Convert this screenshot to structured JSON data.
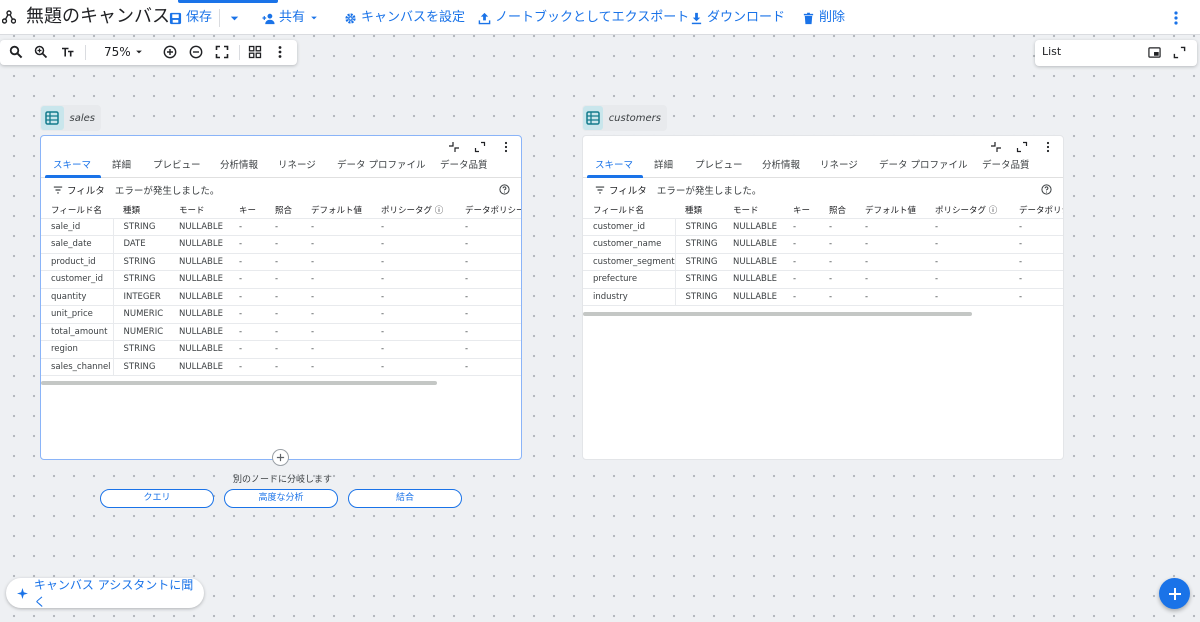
{
  "colors": {
    "accent": "#1a73e8",
    "table_icon_bg": "#c9e6ec"
  },
  "header": {
    "title": "無題のキャンバス",
    "save_label": "保存",
    "share_label": "共有",
    "settings_label": "キャンバスを設定",
    "export_label": "ノートブックとしてエクスポート",
    "download_label": "ダウンロード",
    "delete_label": "削除"
  },
  "toolbar": {
    "zoom": "75%"
  },
  "list_panel": {
    "label": "List"
  },
  "nodes": {
    "sales": {
      "name": "sales",
      "tabs": [
        "スキーマ",
        "詳細",
        "プレビュー",
        "分析情報",
        "リネージ",
        "データ プロファイル",
        "データ品質"
      ],
      "filter_label": "フィルタ",
      "error_text": "エラーが発生しました。",
      "columns": [
        "フィールド名",
        "種類",
        "モード",
        "キー",
        "照合",
        "デフォルト値",
        "ポリシータグ",
        "データポリシー"
      ],
      "rows": [
        [
          "sale_id",
          "STRING",
          "NULLABLE",
          "-",
          "-",
          "-",
          "-",
          "-"
        ],
        [
          "sale_date",
          "DATE",
          "NULLABLE",
          "-",
          "-",
          "-",
          "-",
          "-"
        ],
        [
          "product_id",
          "STRING",
          "NULLABLE",
          "-",
          "-",
          "-",
          "-",
          "-"
        ],
        [
          "customer_id",
          "STRING",
          "NULLABLE",
          "-",
          "-",
          "-",
          "-",
          "-"
        ],
        [
          "quantity",
          "INTEGER",
          "NULLABLE",
          "-",
          "-",
          "-",
          "-",
          "-"
        ],
        [
          "unit_price",
          "NUMERIC",
          "NULLABLE",
          "-",
          "-",
          "-",
          "-",
          "-"
        ],
        [
          "total_amount",
          "NUMERIC",
          "NULLABLE",
          "-",
          "-",
          "-",
          "-",
          "-"
        ],
        [
          "region",
          "STRING",
          "NULLABLE",
          "-",
          "-",
          "-",
          "-",
          "-"
        ],
        [
          "sales_channel",
          "STRING",
          "NULLABLE",
          "-",
          "-",
          "-",
          "-",
          "-"
        ]
      ]
    },
    "customers": {
      "name": "customers",
      "tabs": [
        "スキーマ",
        "詳細",
        "プレビュー",
        "分析情報",
        "リネージ",
        "データ プロファイル",
        "データ品質"
      ],
      "filter_label": "フィルタ",
      "error_text": "エラーが発生しました。",
      "columns": [
        "フィールド名",
        "種類",
        "モード",
        "キー",
        "照合",
        "デフォルト値",
        "ポリシータグ",
        "データポリシ"
      ],
      "rows": [
        [
          "customer_id",
          "STRING",
          "NULLABLE",
          "-",
          "-",
          "-",
          "-",
          "-"
        ],
        [
          "customer_name",
          "STRING",
          "NULLABLE",
          "-",
          "-",
          "-",
          "-",
          "-"
        ],
        [
          "customer_segment",
          "STRING",
          "NULLABLE",
          "-",
          "-",
          "-",
          "-",
          "-"
        ],
        [
          "prefecture",
          "STRING",
          "NULLABLE",
          "-",
          "-",
          "-",
          "-",
          "-"
        ],
        [
          "industry",
          "STRING",
          "NULLABLE",
          "-",
          "-",
          "-",
          "-",
          "-"
        ]
      ]
    }
  },
  "branch": {
    "text": "別のノードに分岐します",
    "buttons": [
      "クエリ",
      "高度な分析",
      "結合"
    ]
  },
  "assistant": {
    "label": "キャンバス アシスタントに聞く"
  }
}
